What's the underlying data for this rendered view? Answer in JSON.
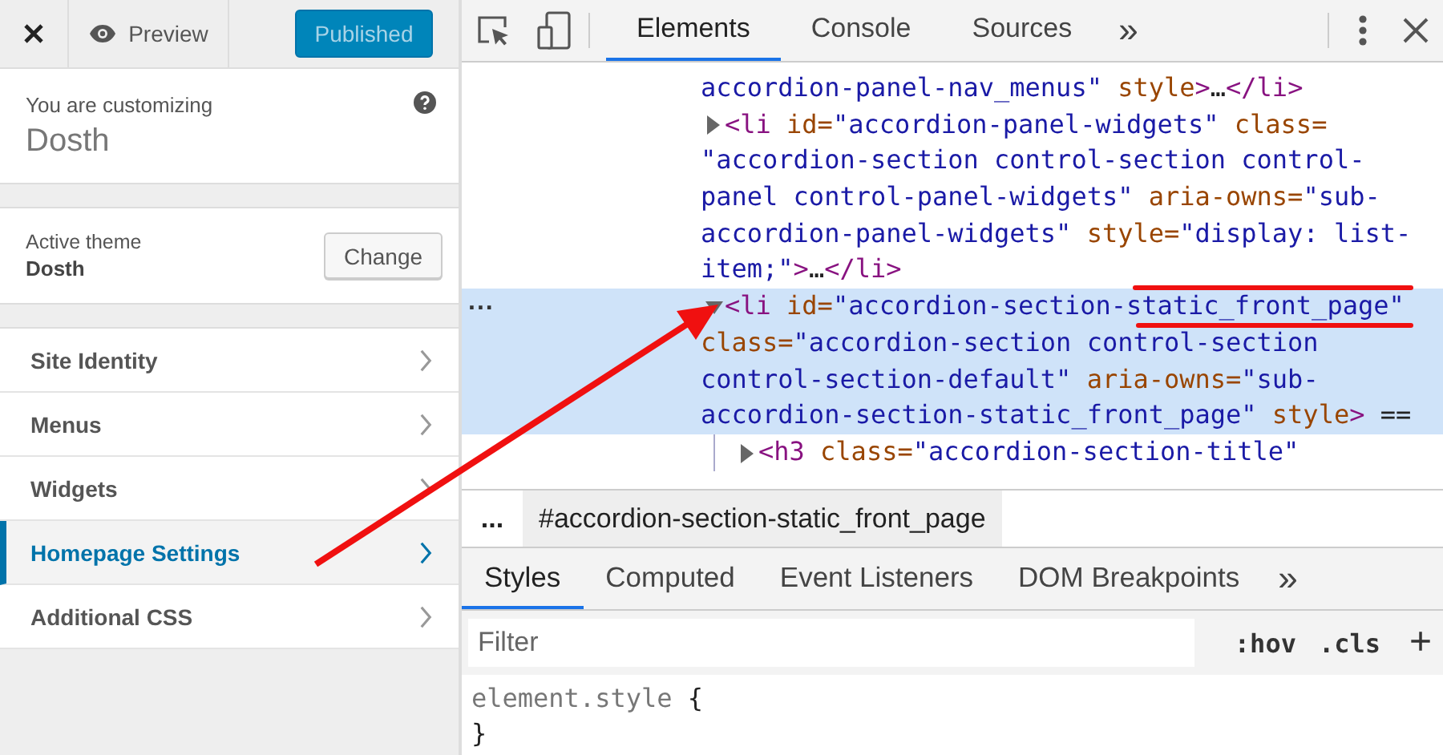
{
  "customizer": {
    "preview": "Preview",
    "publish": {
      "label": "Published",
      "disabled": true
    },
    "intro": "You are customizing",
    "site": "Dosth",
    "theme": {
      "label": "Active theme",
      "name": "Dosth",
      "button": "Change"
    },
    "sections": [
      {
        "label": "Site Identity",
        "selected": false
      },
      {
        "label": "Menus",
        "selected": false
      },
      {
        "label": "Widgets",
        "selected": false
      },
      {
        "label": "Homepage Settings",
        "selected": true
      },
      {
        "label": "Additional CSS",
        "selected": false
      }
    ]
  },
  "devtools": {
    "tabs": [
      {
        "label": "Elements",
        "selected": true
      },
      {
        "label": "Console",
        "selected": false
      },
      {
        "label": "Sources",
        "selected": false
      }
    ],
    "tabs_overflow": "»",
    "dom_nodes": [
      {
        "kind": "fragment",
        "selected": false,
        "lines": [
          [
            {
              "kind": "value",
              "text": "accordion-panel-nav_menus\""
            },
            {
              "kind": "attr",
              "text": " style"
            },
            {
              "kind": "tag",
              "text": ">"
            },
            {
              "kind": "text",
              "text": "…"
            },
            {
              "kind": "tag",
              "text": "</li>"
            }
          ]
        ]
      },
      {
        "kind": "element",
        "expanded": false,
        "selected": false,
        "lines": [
          [
            {
              "kind": "tag",
              "text": "<li"
            },
            {
              "kind": "attr",
              "text": " id="
            },
            {
              "kind": "value",
              "text": "\"accordion-panel-widgets\""
            },
            {
              "kind": "attr",
              "text": " class="
            }
          ],
          [
            {
              "kind": "value",
              "text": "\"accordion-section control-section control-"
            }
          ],
          [
            {
              "kind": "value",
              "text": "panel control-panel-widgets\""
            },
            {
              "kind": "attr",
              "text": " aria-owns="
            },
            {
              "kind": "value",
              "text": "\"sub-"
            }
          ],
          [
            {
              "kind": "value",
              "text": "accordion-panel-widgets\""
            },
            {
              "kind": "attr",
              "text": " style="
            },
            {
              "kind": "value",
              "text": "\"display: list-"
            }
          ],
          [
            {
              "kind": "value",
              "text": "item;\""
            },
            {
              "kind": "tag",
              "text": ">"
            },
            {
              "kind": "text",
              "text": "…"
            },
            {
              "kind": "tag",
              "text": "</li>"
            }
          ]
        ]
      },
      {
        "kind": "element",
        "expanded": true,
        "selected": true,
        "gutter": "...",
        "lines": [
          [
            {
              "kind": "tag",
              "text": "<li"
            },
            {
              "kind": "attr",
              "text": " id="
            },
            {
              "kind": "value",
              "text": "\"accordion-section-static_front_page\""
            }
          ],
          [
            {
              "kind": "attr",
              "text": "class="
            },
            {
              "kind": "value",
              "text": "\"accordion-section control-section"
            }
          ],
          [
            {
              "kind": "value",
              "text": "control-section-default\""
            },
            {
              "kind": "attr",
              "text": " aria-owns="
            },
            {
              "kind": "value",
              "text": "\"sub-"
            }
          ],
          [
            {
              "kind": "value",
              "text": "accordion-section-static_front_page\""
            },
            {
              "kind": "attr",
              "text": " style"
            },
            {
              "kind": "tag",
              "text": ">"
            },
            {
              "kind": "text",
              "text": " =="
            }
          ]
        ],
        "children": [
          {
            "kind": "element",
            "expanded": false,
            "selected": false,
            "lines": [
              [
                {
                  "kind": "tag",
                  "text": "<h3"
                },
                {
                  "kind": "attr",
                  "text": " class="
                },
                {
                  "kind": "value",
                  "text": "\"accordion-section-title\""
                }
              ]
            ]
          }
        ]
      }
    ],
    "breadcrumb": {
      "more": "...",
      "current": "#accordion-section-static_front_page"
    },
    "pane_tabs": [
      {
        "label": "Styles",
        "selected": true
      },
      {
        "label": "Computed",
        "selected": false
      },
      {
        "label": "Event Listeners",
        "selected": false
      },
      {
        "label": "DOM Breakpoints",
        "selected": false
      }
    ],
    "pane_overflow": "»",
    "filter": {
      "placeholder": "Filter"
    },
    "filter_buttons": [
      ":hov",
      ".cls",
      "+"
    ],
    "rules": [
      {
        "selector": "element.style",
        "open": "{",
        "close": "}"
      }
    ]
  }
}
